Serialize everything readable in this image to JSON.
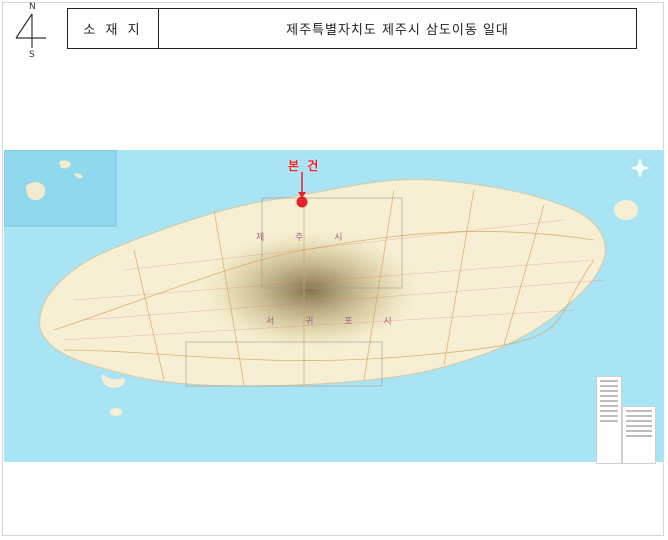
{
  "compass": {
    "north": "N",
    "south": "S"
  },
  "location_table": {
    "label": "소 재 지",
    "value": "제주특별자치도 제주시 삼도이동 일대"
  },
  "map": {
    "marker_label": "본 건",
    "city_labels": [
      "제 주 시",
      "서 귀 포 시"
    ],
    "colors": {
      "sea": "#a9e4f5",
      "land": "#f7efd3",
      "mountain": "#8a7a52",
      "marker": "#e8202a",
      "roads": "#d9a15a"
    }
  }
}
